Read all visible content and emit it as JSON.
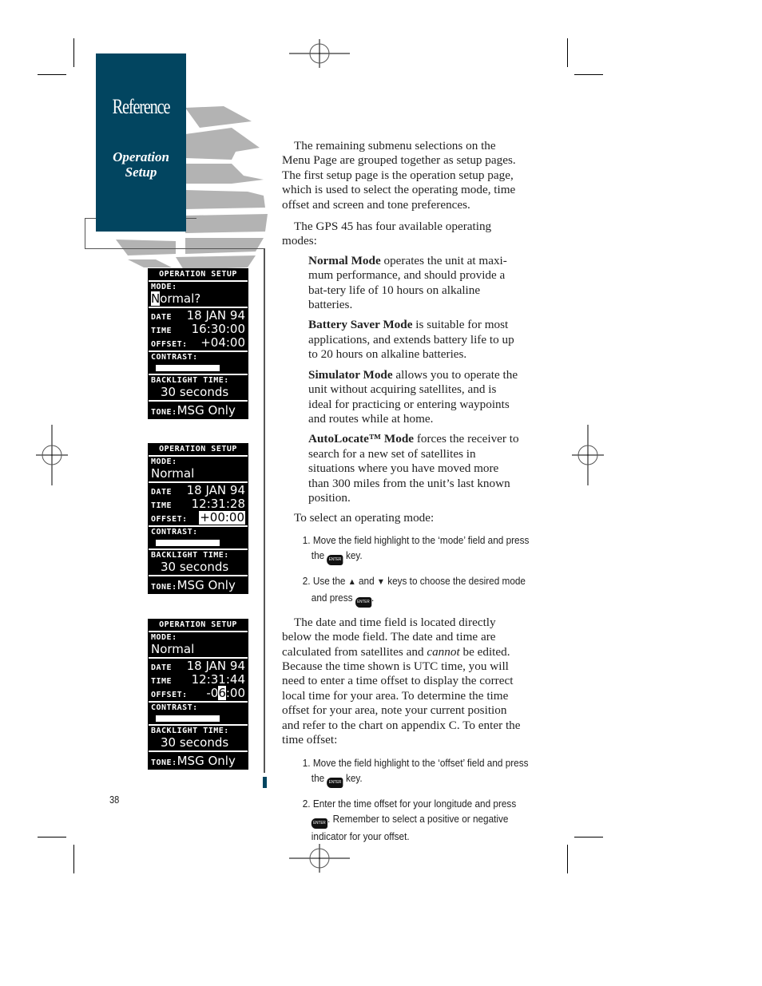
{
  "sidebar": {
    "section_title": "Reference",
    "subsection_line1": "Operation",
    "subsection_line2": "Setup",
    "brand_color": "#024560"
  },
  "screens": [
    {
      "header": "OPERATION SETUP",
      "mode_label": "MODE:",
      "mode_value_cursor": "N",
      "mode_value_rest": "ormal?",
      "date_label": "DATE",
      "date_value": "18 JAN 94",
      "time_label": "TIME",
      "time_value": "16:30:00",
      "offset_label": "OFFSET:",
      "offset_value": "+04:00",
      "contrast_label": "CONTRAST:",
      "backlight_label": "BACKLIGHT TIME:",
      "backlight_value": "30 seconds",
      "tone_label": "TONE:",
      "tone_value": "MSG Only"
    },
    {
      "header": "OPERATION SETUP",
      "mode_label": "MODE:",
      "mode_value": "Normal",
      "date_label": "DATE",
      "date_value": "18 JAN 94",
      "time_label": "TIME",
      "time_value": "12:31:28",
      "offset_label": "OFFSET:",
      "offset_value": "+00:00",
      "contrast_label": "CONTRAST:",
      "backlight_label": "BACKLIGHT TIME:",
      "backlight_value": "30 seconds",
      "tone_label": "TONE:",
      "tone_value": "MSG Only"
    },
    {
      "header": "OPERATION SETUP",
      "mode_label": "MODE:",
      "mode_value": "Normal",
      "date_label": "DATE",
      "date_value": "18 JAN 94",
      "time_label": "TIME",
      "time_value": "12:31:44",
      "offset_label": "OFFSET:",
      "offset_pre": "-0",
      "offset_cursor": "6",
      "offset_post": ":00",
      "contrast_label": "CONTRAST:",
      "backlight_label": "BACKLIGHT TIME:",
      "backlight_value": "30 seconds",
      "tone_label": "TONE:",
      "tone_value": "MSG Only"
    }
  ],
  "content": {
    "intro": "The remaining submenu selections on the Menu Page are grouped together as setup pages. The first setup page is the operation setup page, which is used to select the operating mode, time offset and screen and tone preferences.",
    "modes_intro": "The GPS 45 has four available operating modes:",
    "modes": [
      {
        "name": "Normal Mode",
        "text": " operates the unit at maxi-mum performance, and should provide a bat-tery life of 10 hours on alkaline batteries."
      },
      {
        "name": "Battery Saver Mode",
        "text": " is suitable for most applications, and extends battery life to up to 20 hours on alkaline batteries."
      },
      {
        "name": "Simulator Mode",
        "text": " allows you to operate the unit without acquiring satellites, and is ideal for practicing or entering waypoints and routes while at home."
      },
      {
        "name": "AutoLocate™ Mode",
        "text": " forces the receiver to search for a new set of satellites in situations where you have moved more than 300 miles from the unit’s last known position."
      }
    ],
    "select_intro": "To select an operating mode:",
    "select_steps": {
      "s1_a": "1. Move the field highlight to the ‘mode’ field and press the ",
      "s1_b": " key.",
      "s2_a": "2. Use the ",
      "s2_b": " and ",
      "s2_c": " keys to choose the desired mode and press ",
      "s2_d": "."
    },
    "datetime_a": "The date and time field is located directly below the mode field. The date and time are calculated from satellites and ",
    "datetime_em": "cannot",
    "datetime_b": " be edited. Because the time shown is UTC time, you will need to enter a time offset to display the correct local time for your area. To determine the time offset for your area, note your current position and refer to the chart on appendix C. To enter the time offset:",
    "offset_steps": {
      "s1_a": "1. Move the field highlight to the ‘offset’ field and press the ",
      "s1_b": " key.",
      "s2_a": "2. Enter the time offset for your longitude and press ",
      "s2_b": ". Remember to select a positive or negative indicator for your offset."
    },
    "key_enter": "ENTER",
    "key_up": "▲",
    "key_down": "▼"
  },
  "page_number": "38"
}
